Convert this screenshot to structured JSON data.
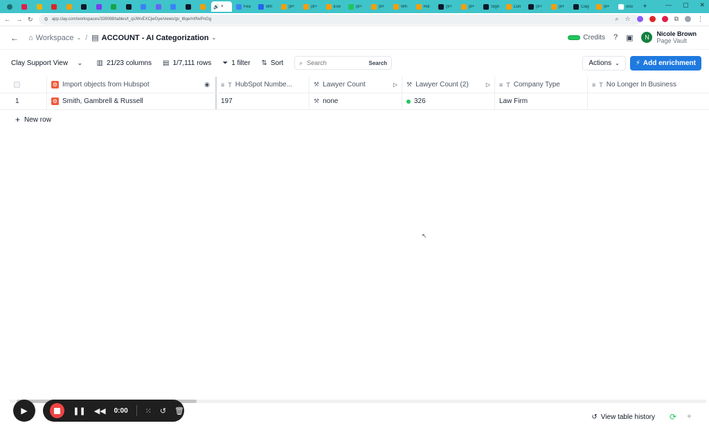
{
  "browser": {
    "tabs": [
      {
        "color": "#e11d48"
      },
      {
        "color": "#eab308"
      },
      {
        "color": "#dc2626"
      },
      {
        "color": "#f59e0b"
      },
      {
        "color": "#111827"
      },
      {
        "color": "#7c3aed"
      },
      {
        "color": "#16a34a"
      },
      {
        "color": "#111827"
      },
      {
        "color": "#3b82f6"
      },
      {
        "color": "#6366f1"
      },
      {
        "color": "#3b82f6"
      },
      {
        "color": "#111827"
      },
      {
        "color": "#f59e0b"
      }
    ],
    "active_tab_label": "",
    "wide_tabs": [
      {
        "label": "Fea",
        "color": "#3b82f6"
      },
      {
        "label": "Wh",
        "color": "#2563eb"
      },
      {
        "label": "(8+",
        "color": "#f59e0b"
      },
      {
        "label": "(8+",
        "color": "#f59e0b"
      },
      {
        "label": "Eve",
        "color": "#f59e0b"
      },
      {
        "label": "(8+",
        "color": "#22c55e"
      },
      {
        "label": "(8+",
        "color": "#f59e0b"
      },
      {
        "label": "Wh",
        "color": "#f59e0b"
      },
      {
        "label": "Hol",
        "color": "#f59e0b"
      },
      {
        "label": "(8+",
        "color": "#111827"
      },
      {
        "label": "(8+",
        "color": "#f59e0b"
      },
      {
        "label": "Sign",
        "color": "#111827"
      },
      {
        "label": "Con",
        "color": "#f59e0b"
      },
      {
        "label": "(8+",
        "color": "#111827"
      },
      {
        "label": "(8+",
        "color": "#f59e0b"
      },
      {
        "label": "Clay",
        "color": "#111827"
      },
      {
        "label": "(8+",
        "color": "#f59e0b"
      },
      {
        "label": "ooo",
        "color": "#ffffff"
      }
    ],
    "url": "app.clay.com/workspaces/339088/tables/t_qUWvEXCjwGye/views/gv_t6qe/mfNvPnGg"
  },
  "topbar": {
    "workspace": "Workspace",
    "separator": "/",
    "table_title": "ACCOUNT - AI Categorization",
    "credits_label": "Credits",
    "user_name": "Nicole Brown",
    "user_org": "Page Vault",
    "avatar_initial": "N"
  },
  "toolbar": {
    "view_name": "Clay Support View",
    "columns": "21/23 columns",
    "rows": "1/7,111 rows",
    "filter": "1 filter",
    "sort": "Sort",
    "search_placeholder": "Search",
    "search_button": "Search",
    "actions": "Actions",
    "add_enrichment": "Add enrichment"
  },
  "table": {
    "headers": {
      "import": "Import objects from Hubspot",
      "hubspot_number": "HubSpot Numbe...",
      "lawyer_count": "Lawyer Count",
      "lawyer_count_2": "Lawyer Count (2)",
      "company_type": "Company Type",
      "no_longer": "No Longer In Business"
    },
    "rows": [
      {
        "index": "1",
        "import": "Smith, Gambrell & Russell",
        "hubspot_number": "197",
        "lawyer_count": "none",
        "lawyer_count_2": "326",
        "company_type": "Law Firm",
        "no_longer": ""
      }
    ],
    "new_row": "New row"
  },
  "recorder": {
    "time": "0:00"
  },
  "footer": {
    "history": "View table history"
  },
  "colors": {
    "accent": "#1f7ae0",
    "hubspot": "#ef5a3c",
    "status_green": "#22c55e",
    "chrome": "#3fc4c9"
  }
}
